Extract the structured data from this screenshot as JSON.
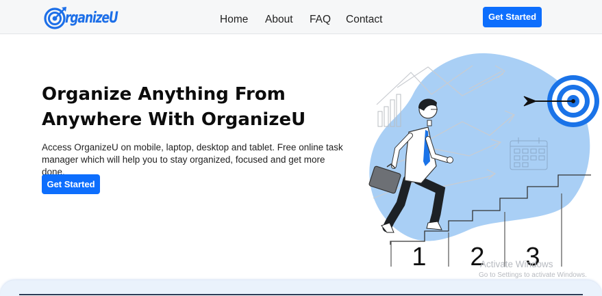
{
  "navbar": {
    "brand": {
      "icon": "target-logo-icon",
      "text": "rganizeU"
    },
    "links": [
      {
        "label": "Home"
      },
      {
        "label": "About"
      },
      {
        "label": "FAQ"
      },
      {
        "label": "Contact"
      }
    ],
    "cta_label": "Get Started"
  },
  "hero": {
    "title": "Organize Anything From Anywhere With OrganizeU",
    "description": "Access OrganizeU on mobile, laptop, desktop and tablet. Free online task manager which will help you to stay organized, focused and get more done.",
    "cta_label": "Get Started",
    "illustration": {
      "step_numbers": [
        "1",
        "2",
        "3"
      ],
      "icons": [
        "target-icon",
        "arrow-icon",
        "calendar-icon",
        "bar-chart-icon",
        "briefcase-icon"
      ]
    }
  },
  "watermark": {
    "title": "Activate Windows",
    "subtitle": "Go to Settings to activate Windows."
  },
  "colors": {
    "accent": "#0d6efd",
    "brand": "#1d6fe8",
    "blob": "#a9cff5",
    "navbar_bg": "#f6f7f8"
  }
}
